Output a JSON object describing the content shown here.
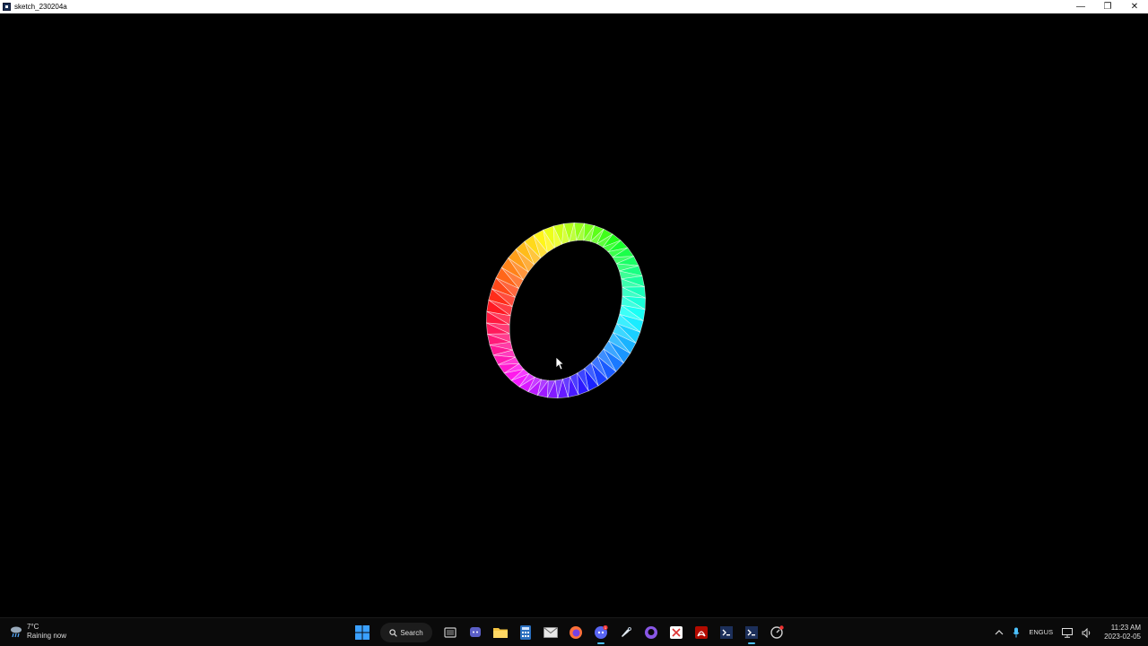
{
  "window": {
    "title": "sketch_230204a",
    "controls": {
      "minimize": "—",
      "restore": "❐",
      "close": "✕"
    }
  },
  "weather": {
    "temperature": "7°C",
    "condition": "Raining now",
    "icon": "rain-cloud-icon"
  },
  "taskbar": {
    "search_label": "Search",
    "apps": [
      {
        "name": "start-icon"
      },
      {
        "name": "task-view-icon"
      },
      {
        "name": "teams-chat-icon"
      },
      {
        "name": "file-explorer-icon"
      },
      {
        "name": "calculator-icon"
      },
      {
        "name": "mail-icon"
      },
      {
        "name": "firefox-icon"
      },
      {
        "name": "discord-icon"
      },
      {
        "name": "steam-icon"
      },
      {
        "name": "github-icon"
      },
      {
        "name": "snipping-tool-icon"
      },
      {
        "name": "acrobat-icon"
      },
      {
        "name": "processing-icon"
      },
      {
        "name": "processing-sketch-icon"
      },
      {
        "name": "speedtest-icon"
      }
    ],
    "discord_badge": "1"
  },
  "tray": {
    "language_top": "ENG",
    "language_bottom": "US",
    "time": "11:23 AM",
    "date": "2023-02-05"
  },
  "colors": {
    "taskbar_bg": "#0a0a0a",
    "accent": "#4cc2ff",
    "canvas_bg": "#000000"
  }
}
